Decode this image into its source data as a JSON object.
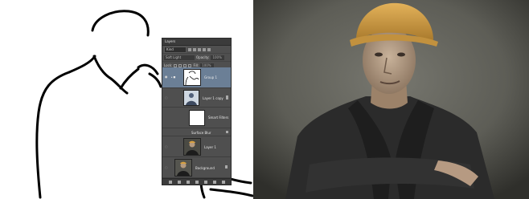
{
  "layers_panel": {
    "tab_title": "Layers",
    "filter_kind": "Kind",
    "blend_mode": "Soft Light",
    "opacity_label": "Opacity:",
    "opacity_value": "100%",
    "lock_label": "Lock:",
    "fill_label": "Fill:",
    "fill_value": "100%",
    "layers": [
      {
        "name": "Group 1",
        "selected": true
      },
      {
        "name": "Layer 1 copy",
        "selected": false
      },
      {
        "name": "Smart Filters",
        "selected": false
      },
      {
        "name": "Surface Blur",
        "selected": false
      },
      {
        "name": "Layer 1",
        "selected": false
      },
      {
        "name": "Background",
        "selected": false
      }
    ]
  },
  "colors": {
    "panel_bg": "#4f4f4f",
    "selection": "#6b7f96",
    "helmet": "#d9a13f",
    "jacket": "#2b2b2b",
    "backdrop": "#5f5f58"
  }
}
